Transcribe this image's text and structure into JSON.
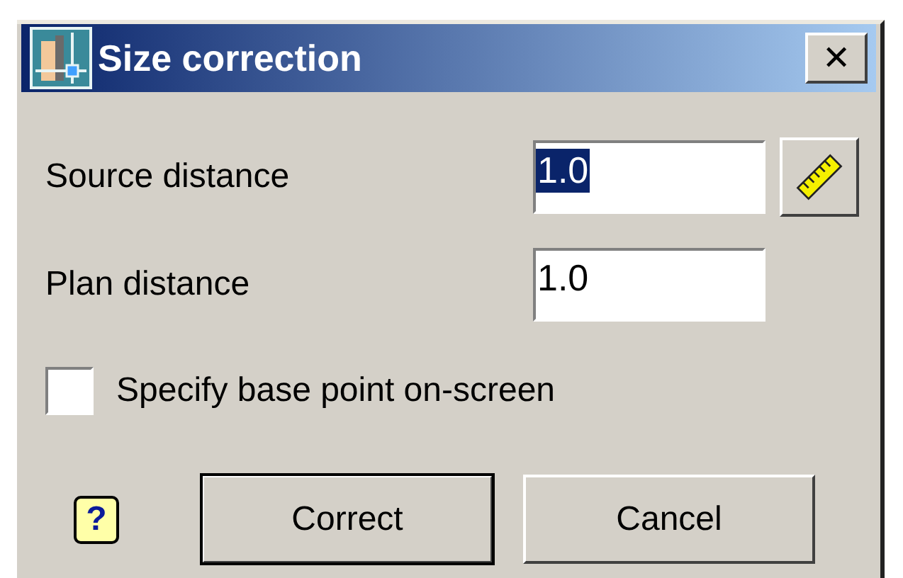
{
  "window": {
    "title": "Size correction",
    "close_label": "✕"
  },
  "fields": [
    {
      "label": "Source distance",
      "value": "1.0",
      "text_selected": true,
      "has_measure_button": true
    },
    {
      "label": "Plan distance",
      "value": "1.0",
      "text_selected": false,
      "has_measure_button": false
    }
  ],
  "checkbox": {
    "label": "Specify base point on-screen",
    "checked": false
  },
  "help": {
    "label": "?"
  },
  "buttons": [
    {
      "label": "Correct",
      "default": true
    },
    {
      "label": "Cancel",
      "default": false
    }
  ]
}
